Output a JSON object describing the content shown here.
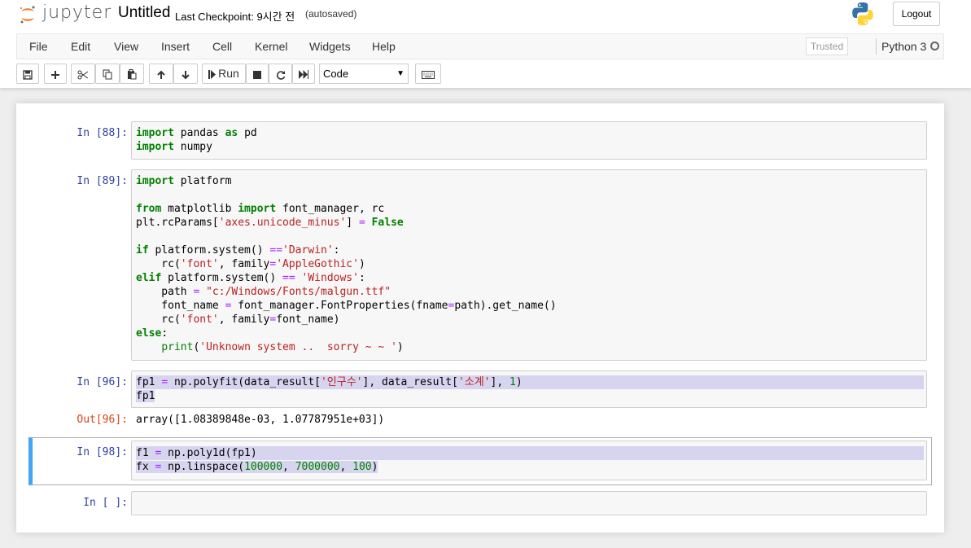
{
  "header": {
    "logo_text": "jupyter",
    "notebook_title": "Untitled",
    "checkpoint": "Last Checkpoint: 9시간 전",
    "autosave_status": "(autosaved)",
    "logout_label": "Logout"
  },
  "menubar": {
    "items": [
      "File",
      "Edit",
      "View",
      "Insert",
      "Cell",
      "Kernel",
      "Widgets",
      "Help"
    ],
    "trusted_label": "Trusted",
    "kernel_name": "Python 3"
  },
  "toolbar": {
    "run_label": "Run",
    "cell_type": "Code",
    "icons": [
      "save-icon",
      "plus-icon",
      "scissors-icon",
      "copy-icon",
      "paste-icon",
      "arrow-up-icon",
      "arrow-down-icon",
      "step-icon",
      "stop-icon",
      "restart-icon",
      "fast-forward-icon",
      "keyboard-icon"
    ]
  },
  "cells": [
    {
      "prompt": "In [88]:",
      "lines": [
        "import pandas as pd",
        "import numpy"
      ]
    },
    {
      "prompt": "In [89]:",
      "lines": [
        "import platform",
        "",
        "from matplotlib import font_manager, rc",
        "plt.rcParams['axes.unicode_minus'] = False",
        "",
        "if platform.system() =='Darwin':",
        "    rc('font', family='AppleGothic')",
        "elif platform.system() == 'Windows':",
        "    path = \"c:/Windows/Fonts/malgun.ttf\"",
        "    font_name = font_manager.FontProperties(fname=path).get_name()",
        "    rc('font', family=font_name)",
        "else:",
        "    print('Unknown system ..  sorry ~ ~ ')"
      ]
    },
    {
      "prompt": "In [96]:",
      "lines": [
        "fp1 = np.polyfit(data_result['인구수'], data_result['소계'], 1)",
        "fp1"
      ],
      "out_prompt": "Out[96]:",
      "output": "array([1.08389848e-03, 1.07787951e+03])"
    },
    {
      "prompt": "In [98]:",
      "lines": [
        "f1 = np.poly1d(fp1)",
        "fx = np.linspace(100000, 7000000, 100)"
      ]
    },
    {
      "prompt": "In [ ]:",
      "lines": [
        ""
      ]
    }
  ],
  "colors": {
    "keyword": "#008000",
    "string": "#ba2121",
    "operator": "#aa22ff",
    "in_prompt": "#303f9f",
    "out_prompt": "#d84315",
    "selected_bar": "#42a5f5"
  }
}
